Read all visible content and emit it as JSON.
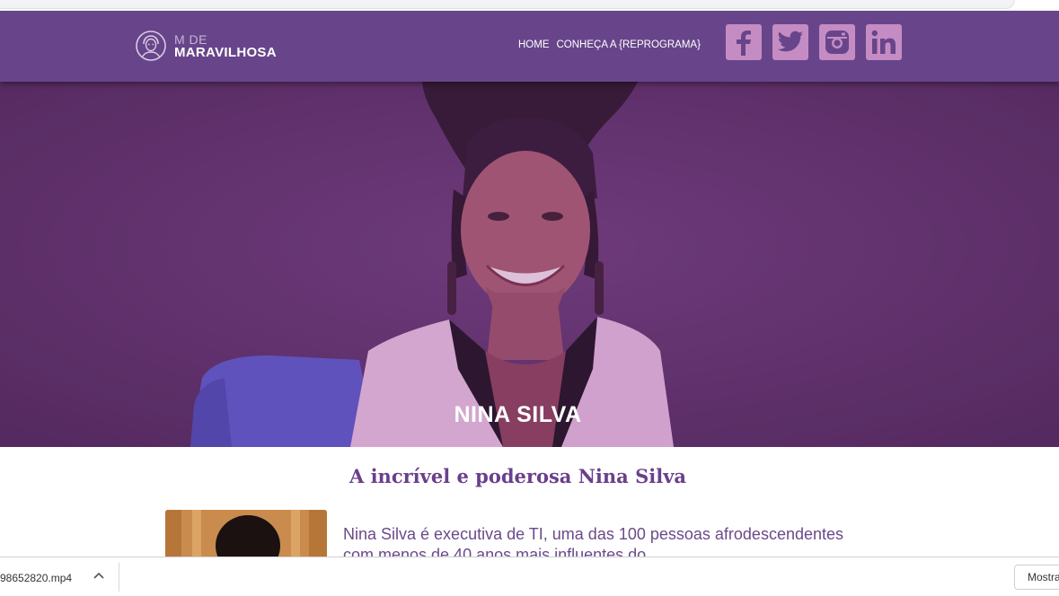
{
  "header": {
    "logo_small": "M DE",
    "logo_big": "MARAVILHOSA",
    "nav": [
      "HOME",
      "CONHEÇA A {REPROGRAMA}"
    ],
    "socials": [
      "facebook-icon",
      "twitter-icon",
      "instagram-icon",
      "linkedin-icon"
    ],
    "colors": {
      "header_bg": "#68458a",
      "social_bg": "#c58cc4"
    }
  },
  "hero": {
    "title": "NINA SILVA",
    "overlay_color": "#5b2f66"
  },
  "content": {
    "section_title": "A incrível e poderosa Nina Silva",
    "bio_text": "Nina Silva é executiva de TI, uma das 100 pessoas afrodescendentes com menos de 40 anos mais influentes do"
  },
  "download_bar": {
    "file_name": "98652820.mp4",
    "show_all_label": "Mostrar tudo"
  }
}
